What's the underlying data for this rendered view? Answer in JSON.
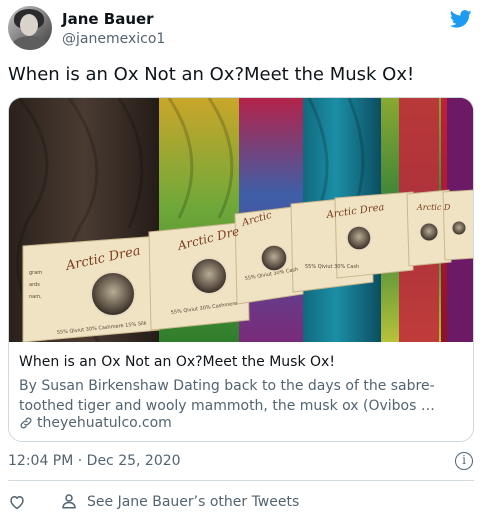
{
  "author": {
    "name": "Jane Bauer",
    "handle": "@janemexico1"
  },
  "tweet": {
    "text": "When is an Ox Not an Ox?Meet the Musk Ox!",
    "timestamp": "12:04 PM · Dec 25, 2020"
  },
  "card": {
    "title": "When is an Ox Not an Ox?Meet the Musk Ox!",
    "description": "By Susan Birkenshaw Dating back to the days of the sabre-toothed tiger and wooly mammoth, the musk ox (Ovibos …",
    "domain": "theyehuatulco.com",
    "image_label_text": "Arctic Dreams",
    "image_label_fine_print": "55% Qiviut 30% Cashmere 15% Silk"
  },
  "footer": {
    "other_tweets": "See Jane Bauer’s other Tweets"
  },
  "icons": {
    "brand": "twitter-bird-icon",
    "link": "link-icon",
    "info": "info-icon",
    "like": "heart-icon",
    "profile": "person-icon"
  },
  "colors": {
    "twitter_blue": "#1d9bf0",
    "secondary_text": "#536471",
    "border": "#cfd9de"
  }
}
